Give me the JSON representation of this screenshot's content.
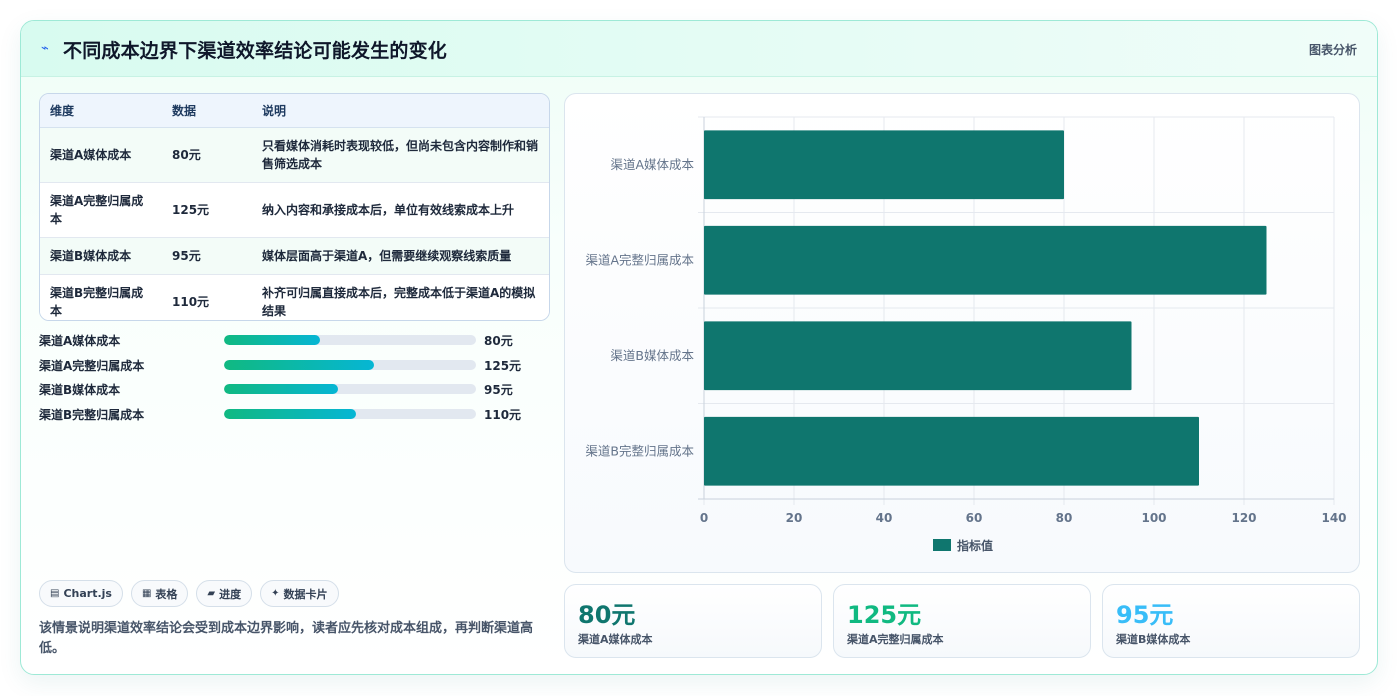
{
  "header": {
    "icon": "sparkle-icon",
    "title": "不同成本边界下渠道效率结论可能发生的变化",
    "tag": "图表分析"
  },
  "table": {
    "headers": [
      "维度",
      "数据",
      "说明"
    ],
    "rows": [
      [
        "渠道A媒体成本",
        "80元",
        "只看媒体消耗时表现较低，但尚未包含内容制作和销售筛选成本"
      ],
      [
        "渠道A完整归属成本",
        "125元",
        "纳入内容和承接成本后，单位有效线索成本上升"
      ],
      [
        "渠道B媒体成本",
        "95元",
        "媒体层面高于渠道A，但需要继续观察线索质量"
      ],
      [
        "渠道B完整归属成本",
        "110元",
        "补齐可归属直接成本后，完整成本低于渠道A的模拟结果"
      ]
    ]
  },
  "progress": {
    "max": 210,
    "items": [
      {
        "label": "渠道A媒体成本",
        "value": 80,
        "text": "80元"
      },
      {
        "label": "渠道A完整归属成本",
        "value": 125,
        "text": "125元"
      },
      {
        "label": "渠道B媒体成本",
        "value": 95,
        "text": "95元"
      },
      {
        "label": "渠道B完整归属成本",
        "value": 110,
        "text": "110元"
      }
    ]
  },
  "chips": [
    {
      "icon": "chart-icon",
      "glyph": "▤",
      "label": "Chart.js"
    },
    {
      "icon": "table-icon",
      "glyph": "▦",
      "label": "表格"
    },
    {
      "icon": "progress-icon",
      "glyph": "▰",
      "label": "进度"
    },
    {
      "icon": "card-icon",
      "glyph": "✦",
      "label": "数据卡片"
    }
  ],
  "note": "该情景说明渠道效率结论会受到成本边界影响，读者应先核对成本组成，再判断渠道高低。",
  "chart_data": {
    "type": "bar",
    "orientation": "horizontal",
    "categories": [
      "渠道A媒体成本",
      "渠道A完整归属成本",
      "渠道B媒体成本",
      "渠道B完整归属成本"
    ],
    "series": [
      {
        "name": "指标值",
        "values": [
          80,
          125,
          95,
          110
        ]
      }
    ],
    "xlim": [
      0,
      140
    ],
    "xticks": [
      0,
      20,
      40,
      60,
      80,
      100,
      120,
      140
    ],
    "grid": true,
    "legend": "bottom",
    "colors": {
      "bar": "#0f766e",
      "grid": "#e5e9ef",
      "axis": "#c9d2dc",
      "tick": "#64748b"
    }
  },
  "stats": [
    {
      "value": "80元",
      "label": "渠道A媒体成本",
      "color": "#0f766e"
    },
    {
      "value": "125元",
      "label": "渠道A完整归属成本",
      "color": "#10b981"
    },
    {
      "value": "95元",
      "label": "渠道B媒体成本",
      "color": "#38bdf8"
    }
  ]
}
